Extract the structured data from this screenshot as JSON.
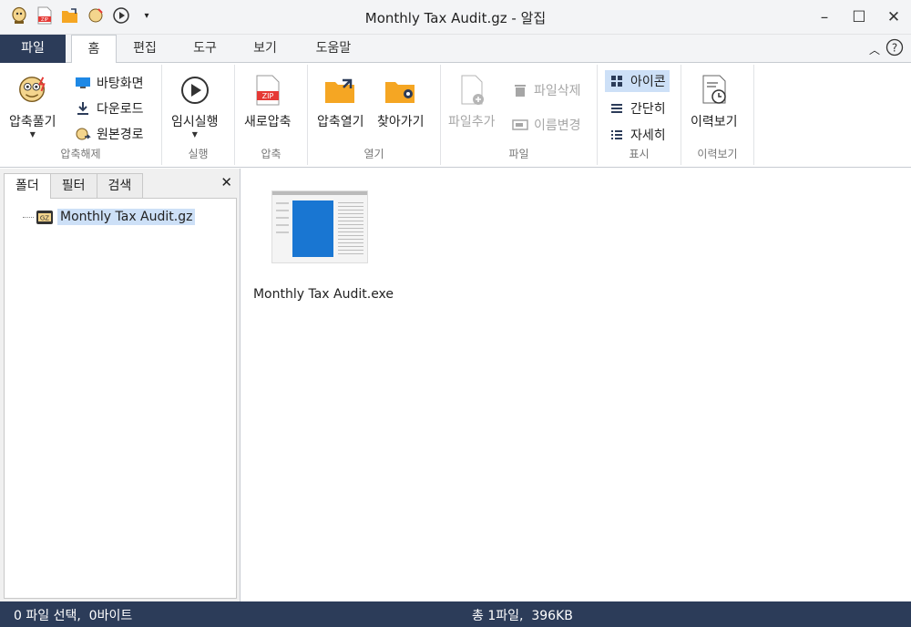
{
  "window": {
    "title": "Monthly Tax Audit.gz - 알집"
  },
  "colors": {
    "accent": "#2c3c59",
    "selection": "#cde0f7",
    "zip_red": "#e53935",
    "folder": "#f5a623"
  },
  "tabs": [
    "파일",
    "홈",
    "편집",
    "도구",
    "보기",
    "도움말"
  ],
  "ribbon": {
    "groups": {
      "extract": {
        "label": "압축해제",
        "big": "압축풀기",
        "items": [
          "바탕화면",
          "다운로드",
          "원본경로"
        ]
      },
      "run": {
        "label": "실행",
        "big": "임시실행"
      },
      "compress": {
        "label": "압축",
        "big": "새로압축"
      },
      "open": {
        "label": "열기",
        "b1": "압축열기",
        "b2": "찾아가기"
      },
      "file": {
        "label": "파일",
        "big": "파일추가",
        "items": [
          "파일삭제",
          "이름변경"
        ]
      },
      "view": {
        "label": "표시",
        "items": [
          "아이콘",
          "간단히",
          "자세히"
        ]
      },
      "history": {
        "label": "이력보기",
        "big": "이력보기"
      }
    }
  },
  "left_pane": {
    "tabs": [
      "폴더",
      "필터",
      "검색"
    ],
    "tree_item": "Monthly Tax Audit.gz",
    "tree_icon_text": "GZ"
  },
  "main": {
    "files": [
      {
        "name": "Monthly Tax Audit.exe"
      }
    ]
  },
  "status": {
    "left": "0 파일 선택,  0바이트",
    "center": "총 1파일,  396KB"
  }
}
